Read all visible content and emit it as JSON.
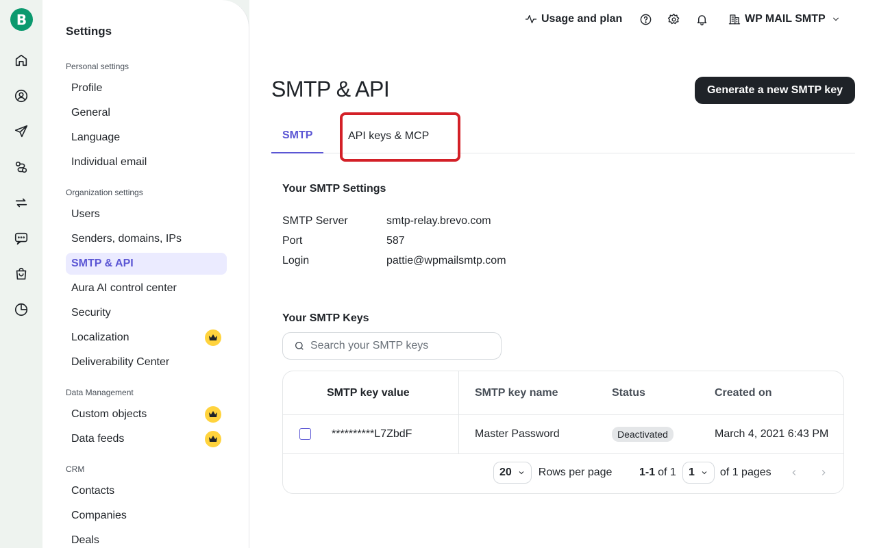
{
  "rail": {
    "logo_letter": "B",
    "icons": [
      "home-icon",
      "contacts-icon",
      "campaigns-icon",
      "automations-icon",
      "transactional-icon",
      "conversations-icon",
      "ecommerce-icon",
      "reports-icon"
    ]
  },
  "sidebar": {
    "title": "Settings",
    "personal_label": "Personal settings",
    "personal_items": [
      "Profile",
      "General",
      "Language",
      "Individual email"
    ],
    "org_label": "Organization settings",
    "org_items": [
      "Users",
      "Senders, domains, IPs",
      "SMTP & API",
      "Aura AI control center",
      "Security",
      "Localization",
      "Deliverability Center"
    ],
    "data_label": "Data Management",
    "data_items": [
      "Custom objects",
      "Data feeds"
    ],
    "crm_label": "CRM",
    "crm_items": [
      "Contacts",
      "Companies",
      "Deals"
    ]
  },
  "topbar": {
    "usage": "Usage and plan",
    "account": "WP MAIL SMTP"
  },
  "page": {
    "title": "SMTP & API",
    "generate_btn": "Generate a new SMTP key",
    "tabs": [
      "SMTP",
      "API keys & MCP"
    ]
  },
  "smtp_settings": {
    "heading": "Your SMTP Settings",
    "rows": [
      {
        "label": "SMTP Server",
        "value": "smtp-relay.brevo.com"
      },
      {
        "label": "Port",
        "value": "587"
      },
      {
        "label": "Login",
        "value": "pattie@wpmailsmtp.com"
      }
    ]
  },
  "smtp_keys": {
    "heading": "Your SMTP Keys",
    "search_placeholder": "Search your SMTP keys",
    "columns": [
      "SMTP key value",
      "SMTP key name",
      "Status",
      "Created on"
    ],
    "rows": [
      {
        "value": "**********L7ZbdF",
        "name": "Master Password",
        "status": "Deactivated",
        "created": "March 4, 2021 6:43 PM"
      }
    ],
    "pagination": {
      "rows_per_page_value": "20",
      "rows_per_page_label": "Rows per page",
      "range_bold": "1-1",
      "range_rest": "of 1",
      "page_value": "1",
      "pages_label": "of 1 pages"
    }
  },
  "colors": {
    "accent": "#5b56d4",
    "brand": "#0b996e",
    "highlight": "#d32027",
    "premium": "#ffd33d"
  }
}
